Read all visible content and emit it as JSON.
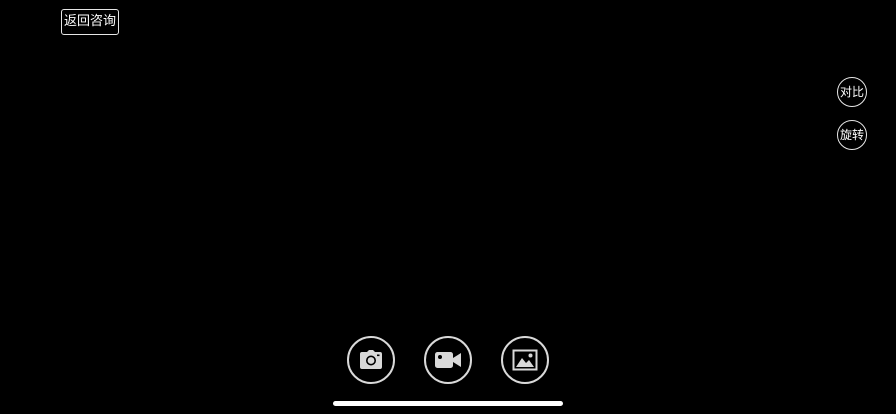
{
  "header": {
    "back_label": "返回咨询"
  },
  "side_controls": {
    "compare_label": "对比",
    "rotate_label": "旋转"
  },
  "bottom_controls": {
    "photo_icon": "camera-icon",
    "video_icon": "video-camera-icon",
    "album_icon": "image-gallery-icon"
  },
  "colors": {
    "background": "#000000",
    "foreground": "#ffffff",
    "ring": "#d9d9d9"
  }
}
